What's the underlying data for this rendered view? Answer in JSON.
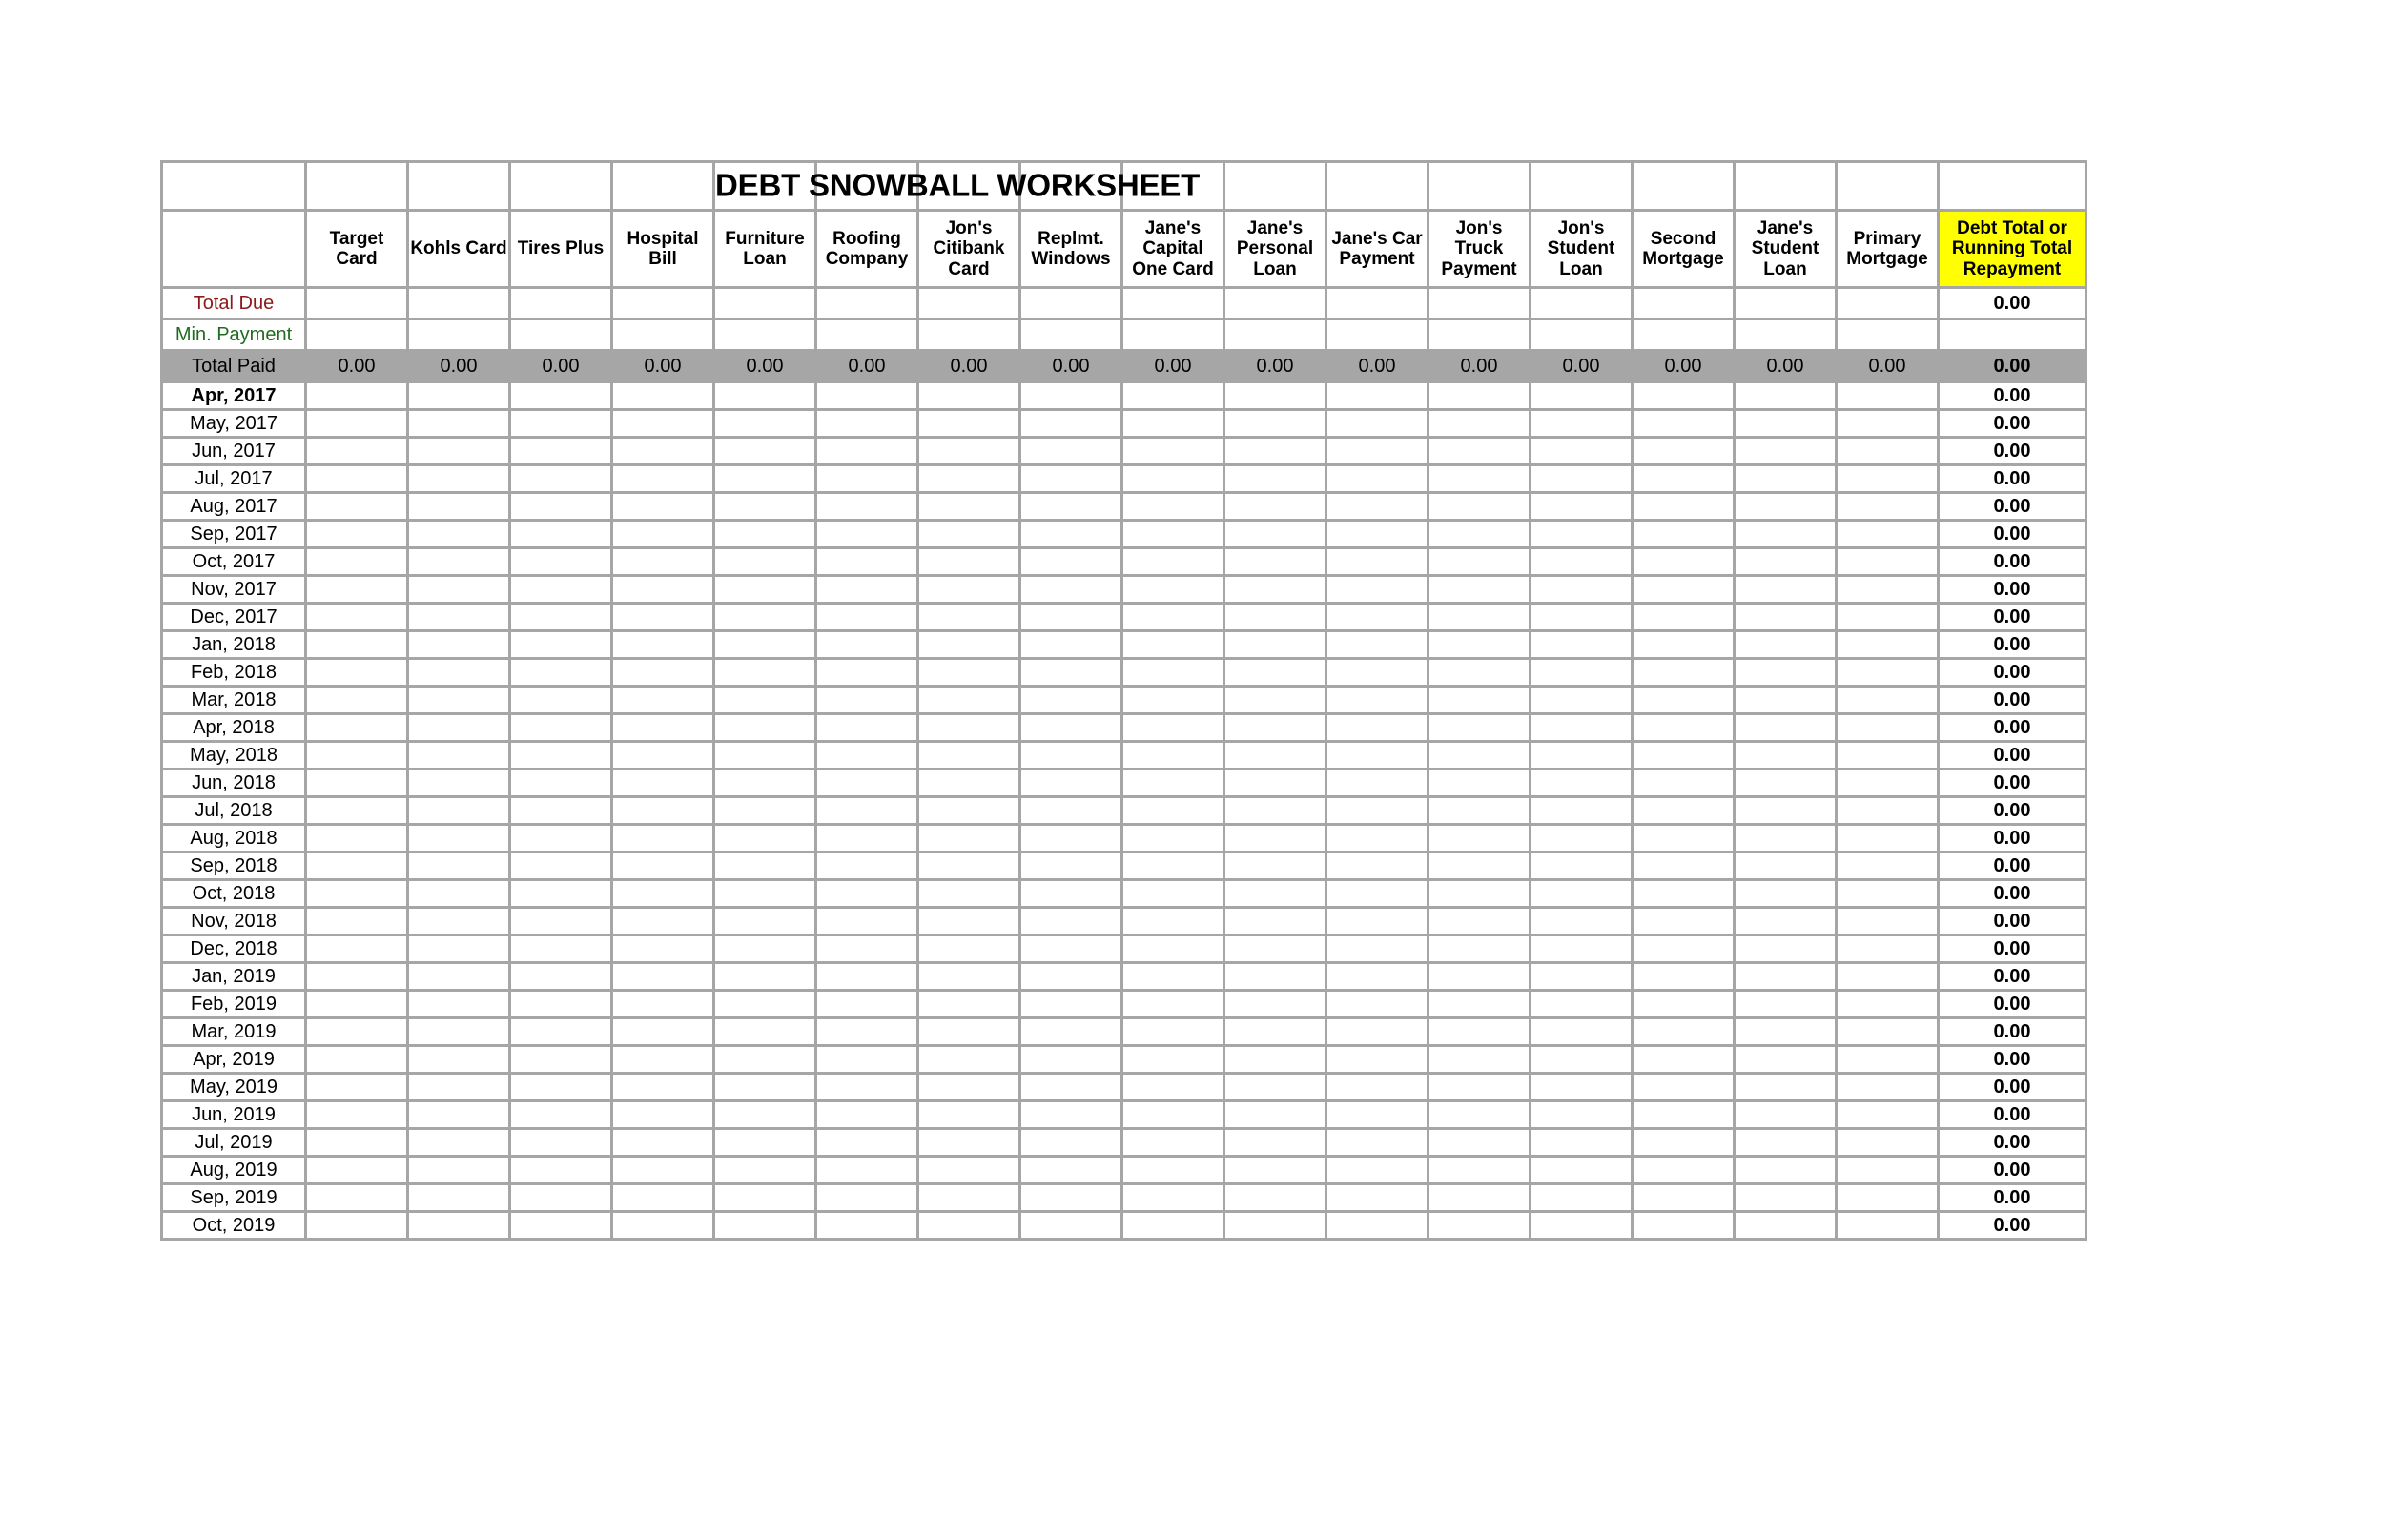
{
  "title": "DEBT SNOWBALL WORKSHEET",
  "colors": {
    "header_fill": "#ffff00",
    "total_due_fill": "#fcd5d5",
    "total_due_text": "#8b1a1a",
    "min_payment_fill": "#cdeccd",
    "min_payment_text": "#1f6b1f",
    "total_paid_fill": "#a6a6a6",
    "month_label_fill": "#c3c3c3",
    "running_total_fill": "#a6a6a6",
    "grid_line": "#a6a6a6"
  },
  "debt_columns": [
    "Target Card",
    "Kohls Card",
    "Tires Plus",
    "Hospital Bill",
    "Furniture Loan",
    "Roofing Company",
    "Jon's Citibank Card",
    "Replmt. Windows",
    "Jane's Capital One Card",
    "Jane's Personal Loan",
    "Jane's Car Payment",
    "Jon's Truck Payment",
    "Jon's Student Loan",
    "Second Mortgage",
    "Jane's Student Loan",
    "Primary Mortgage"
  ],
  "running_total_header": "Debt Total or Running Total Repayment",
  "rows": {
    "total_due": {
      "label": "Total Due",
      "values": [
        "",
        "",
        "",
        "",
        "",
        "",
        "",
        "",
        "",
        "",
        "",
        "",
        "",
        "",
        "",
        ""
      ],
      "running_total": "0.00"
    },
    "min_payment": {
      "label": "Min. Payment",
      "values": [
        "",
        "",
        "",
        "",
        "",
        "",
        "",
        "",
        "",
        "",
        "",
        "",
        "",
        "",
        "",
        ""
      ],
      "running_total": ""
    },
    "total_paid": {
      "label": "Total Paid",
      "values": [
        "0.00",
        "0.00",
        "0.00",
        "0.00",
        "0.00",
        "0.00",
        "0.00",
        "0.00",
        "0.00",
        "0.00",
        "0.00",
        "0.00",
        "0.00",
        "0.00",
        "0.00",
        "0.00"
      ],
      "running_total": "0.00"
    }
  },
  "months": [
    {
      "label": "Apr, 2017",
      "active": true,
      "running_total": "0.00"
    },
    {
      "label": "May, 2017",
      "active": false,
      "running_total": "0.00"
    },
    {
      "label": "Jun, 2017",
      "active": false,
      "running_total": "0.00"
    },
    {
      "label": "Jul, 2017",
      "active": false,
      "running_total": "0.00"
    },
    {
      "label": "Aug, 2017",
      "active": false,
      "running_total": "0.00"
    },
    {
      "label": "Sep, 2017",
      "active": false,
      "running_total": "0.00"
    },
    {
      "label": "Oct, 2017",
      "active": false,
      "running_total": "0.00"
    },
    {
      "label": "Nov, 2017",
      "active": false,
      "running_total": "0.00"
    },
    {
      "label": "Dec, 2017",
      "active": false,
      "running_total": "0.00"
    },
    {
      "label": "Jan, 2018",
      "active": false,
      "running_total": "0.00"
    },
    {
      "label": "Feb, 2018",
      "active": false,
      "running_total": "0.00"
    },
    {
      "label": "Mar, 2018",
      "active": false,
      "running_total": "0.00"
    },
    {
      "label": "Apr, 2018",
      "active": false,
      "running_total": "0.00"
    },
    {
      "label": "May, 2018",
      "active": false,
      "running_total": "0.00"
    },
    {
      "label": "Jun, 2018",
      "active": false,
      "running_total": "0.00"
    },
    {
      "label": "Jul, 2018",
      "active": false,
      "running_total": "0.00"
    },
    {
      "label": "Aug, 2018",
      "active": false,
      "running_total": "0.00"
    },
    {
      "label": "Sep, 2018",
      "active": false,
      "running_total": "0.00"
    },
    {
      "label": "Oct, 2018",
      "active": false,
      "running_total": "0.00"
    },
    {
      "label": "Nov, 2018",
      "active": false,
      "running_total": "0.00"
    },
    {
      "label": "Dec, 2018",
      "active": false,
      "running_total": "0.00"
    },
    {
      "label": "Jan, 2019",
      "active": false,
      "running_total": "0.00"
    },
    {
      "label": "Feb, 2019",
      "active": false,
      "running_total": "0.00"
    },
    {
      "label": "Mar, 2019",
      "active": false,
      "running_total": "0.00"
    },
    {
      "label": "Apr, 2019",
      "active": false,
      "running_total": "0.00"
    },
    {
      "label": "May, 2019",
      "active": false,
      "running_total": "0.00"
    },
    {
      "label": "Jun, 2019",
      "active": false,
      "running_total": "0.00"
    },
    {
      "label": "Jul, 2019",
      "active": false,
      "running_total": "0.00"
    },
    {
      "label": "Aug, 2019",
      "active": false,
      "running_total": "0.00"
    },
    {
      "label": "Sep, 2019",
      "active": false,
      "running_total": "0.00"
    },
    {
      "label": "Oct, 2019",
      "active": false,
      "running_total": "0.00"
    }
  ]
}
